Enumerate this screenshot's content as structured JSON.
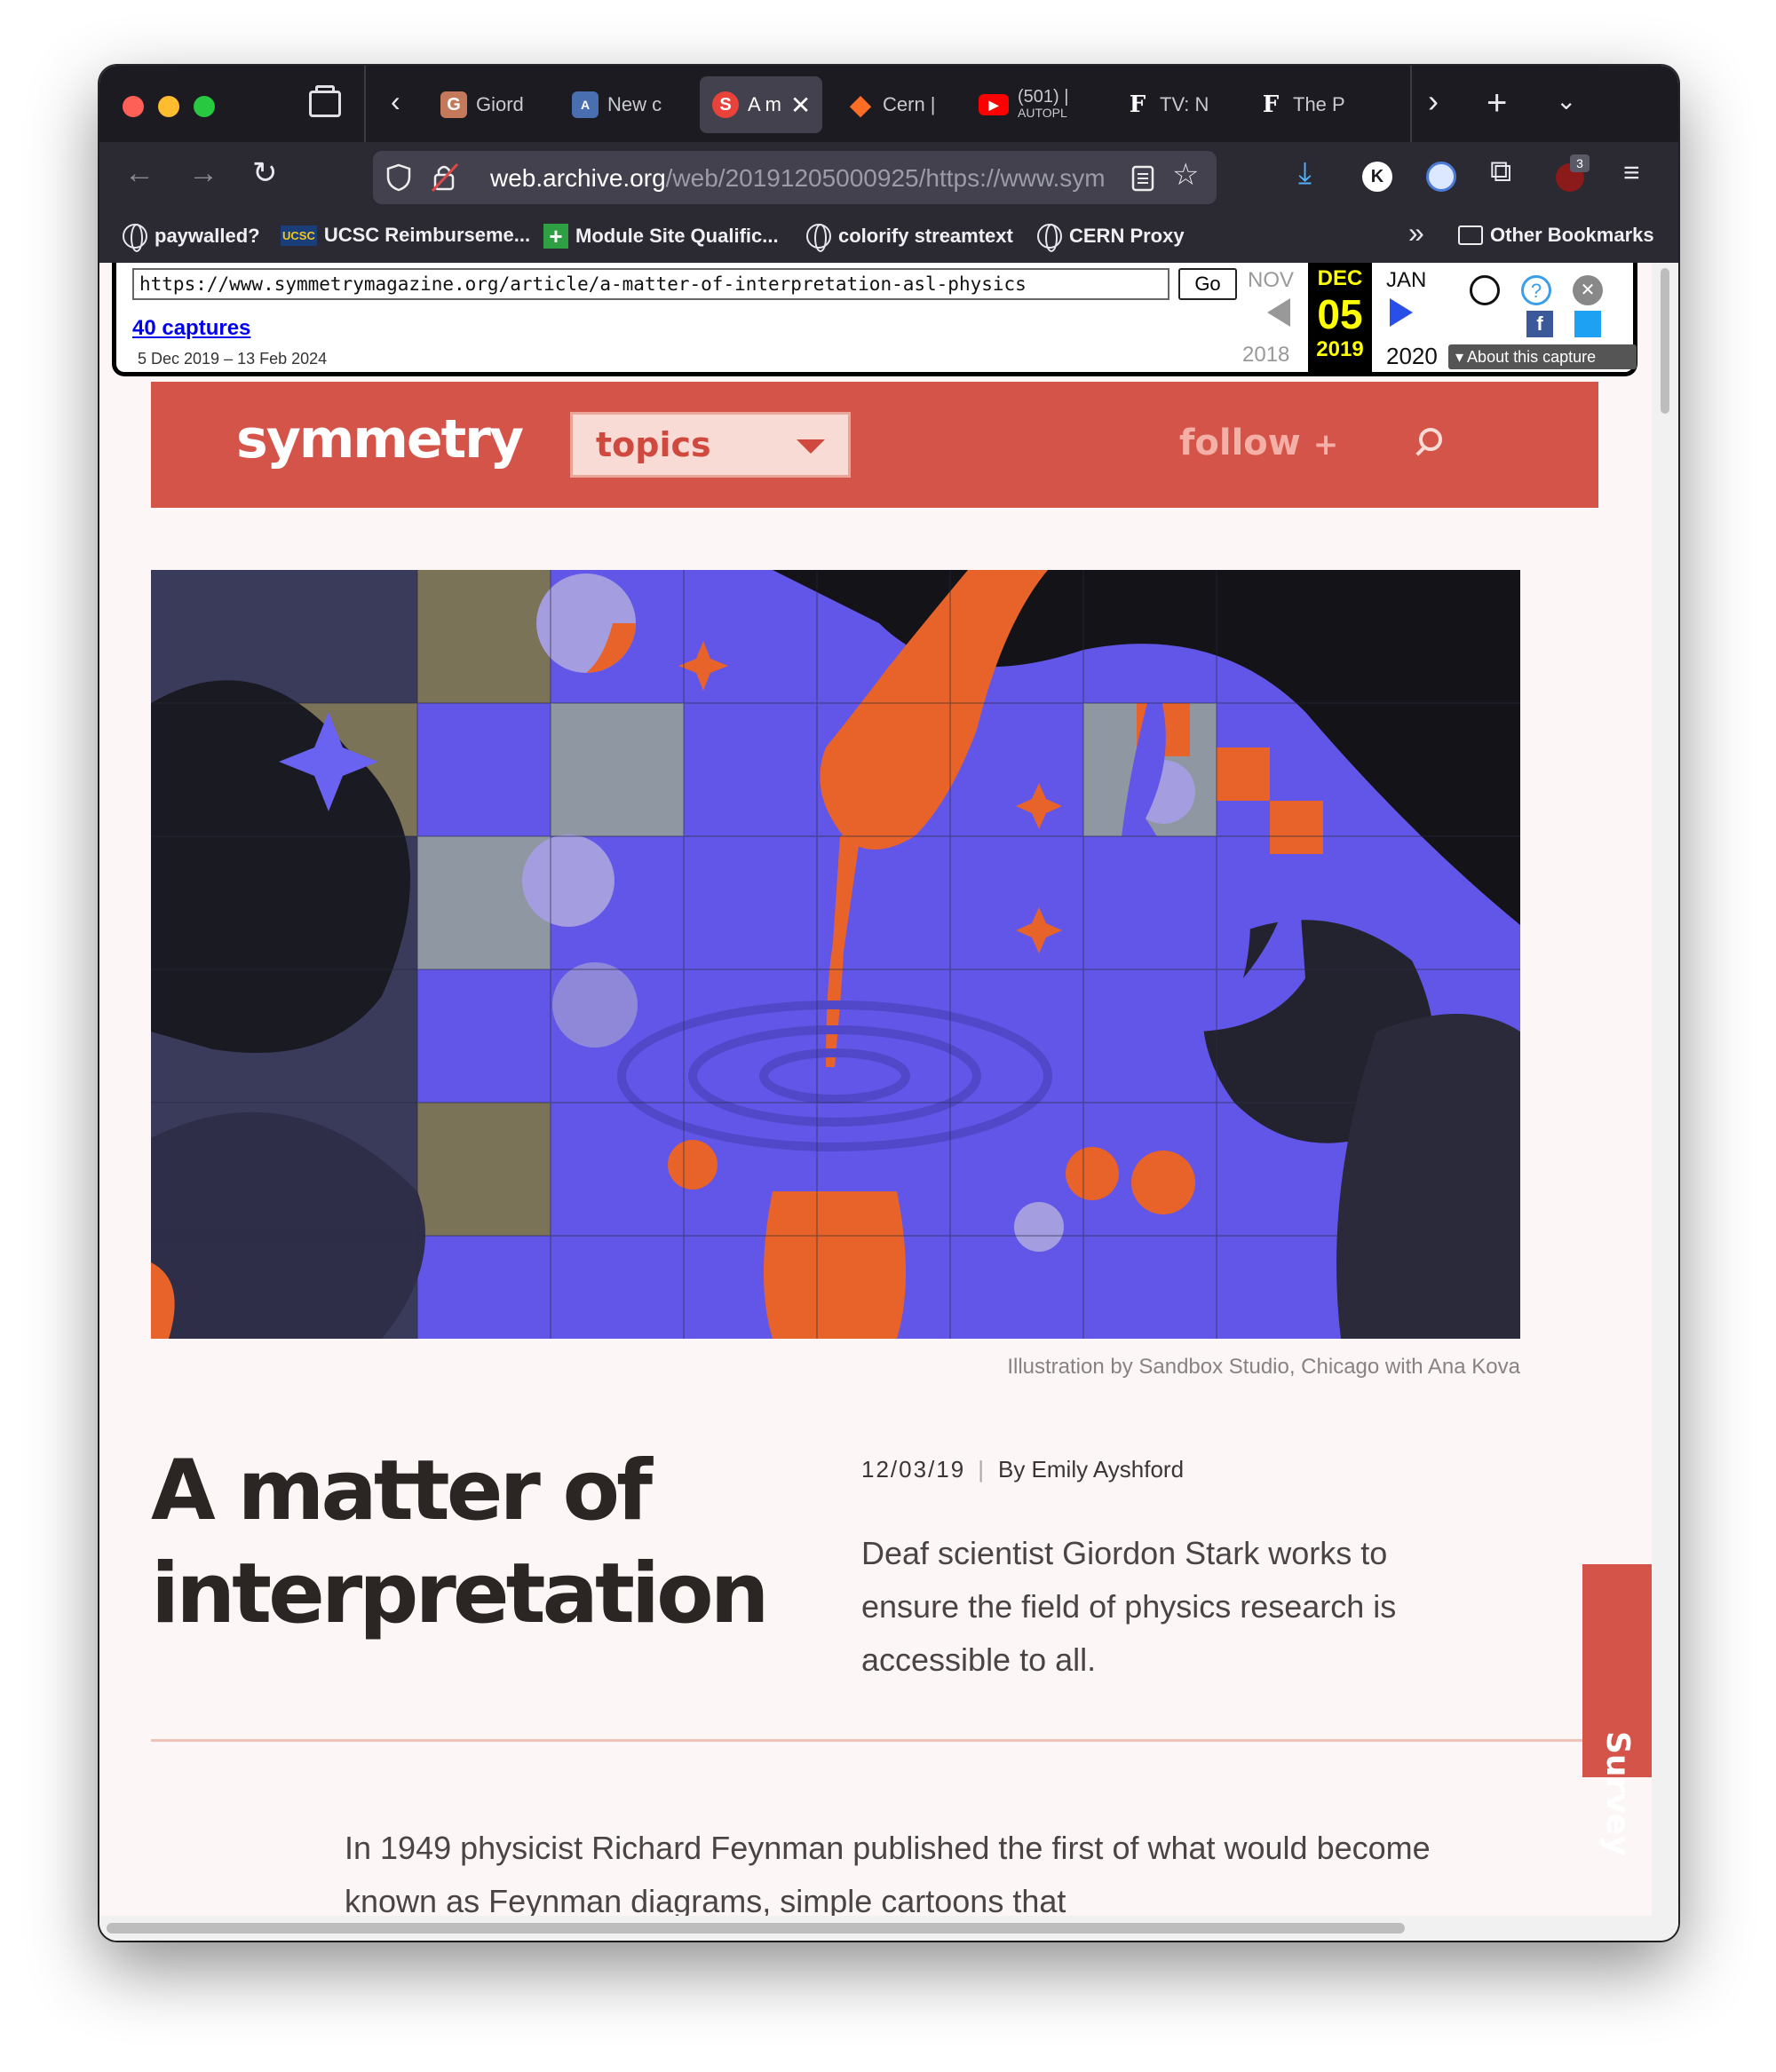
{
  "browser": {
    "tabs": [
      {
        "label": "Giord",
        "favicon": "G"
      },
      {
        "label": "New c",
        "favicon": "A"
      },
      {
        "label": "A m",
        "favicon": "S"
      },
      {
        "label": "Cern |",
        "favicon": "gitlab-fox"
      },
      {
        "label": "(501) |",
        "sublabel": "AUTOPL",
        "favicon": "youtube"
      },
      {
        "label": "TV: N",
        "favicon": "F"
      },
      {
        "label": "The P",
        "favicon": "F"
      }
    ],
    "url_host": "web.archive.org",
    "url_path": "/web/20191205000925/https://www.sym",
    "extensions_badge": "3",
    "profile_initial": "K",
    "bookmarks": [
      {
        "label": "paywalled?",
        "icon": "globe-icon"
      },
      {
        "label": "UCSC Reimburseme...",
        "icon": "ucsc-icon",
        "icon_text": "UCSC"
      },
      {
        "label": "Module Site Qualific...",
        "icon": "plus-icon"
      },
      {
        "label": "colorify streamtext",
        "icon": "globe-icon"
      },
      {
        "label": "CERN Proxy",
        "icon": "globe-icon"
      }
    ],
    "other_bookmarks": "Other Bookmarks"
  },
  "wayback": {
    "url": "https://www.symmetrymagazine.org/article/a-matter-of-interpretation-asl-physics",
    "go_label": "Go",
    "captures": "40 captures",
    "range": "5 Dec 2019 – 13 Feb 2024",
    "prev_month": "NOV",
    "cur_month": "DEC",
    "next_month": "JAN",
    "day": "05",
    "prev_year": "2018",
    "cur_year": "2019",
    "next_year": "2020",
    "about": "About this capture"
  },
  "site": {
    "logo": "symmetry",
    "topics": "topics",
    "follow": "follow",
    "follow_plus": "+",
    "brand_color": "#d4544a"
  },
  "article": {
    "caption": "Illustration by Sandbox Studio, Chicago with Ana Kova",
    "title_line1": "A matter of",
    "title_line2": "interpretation",
    "date": "12/03/19",
    "separator": "|",
    "author": "By Emily Ayshford",
    "dek": "Deaf scientist Giordon Stark works to ensure the field of physics research is accessible to all.",
    "body": "In 1949 physicist Richard Feynman published the first of what would become known as Feynman diagrams, simple cartoons that"
  },
  "survey": "Survey"
}
